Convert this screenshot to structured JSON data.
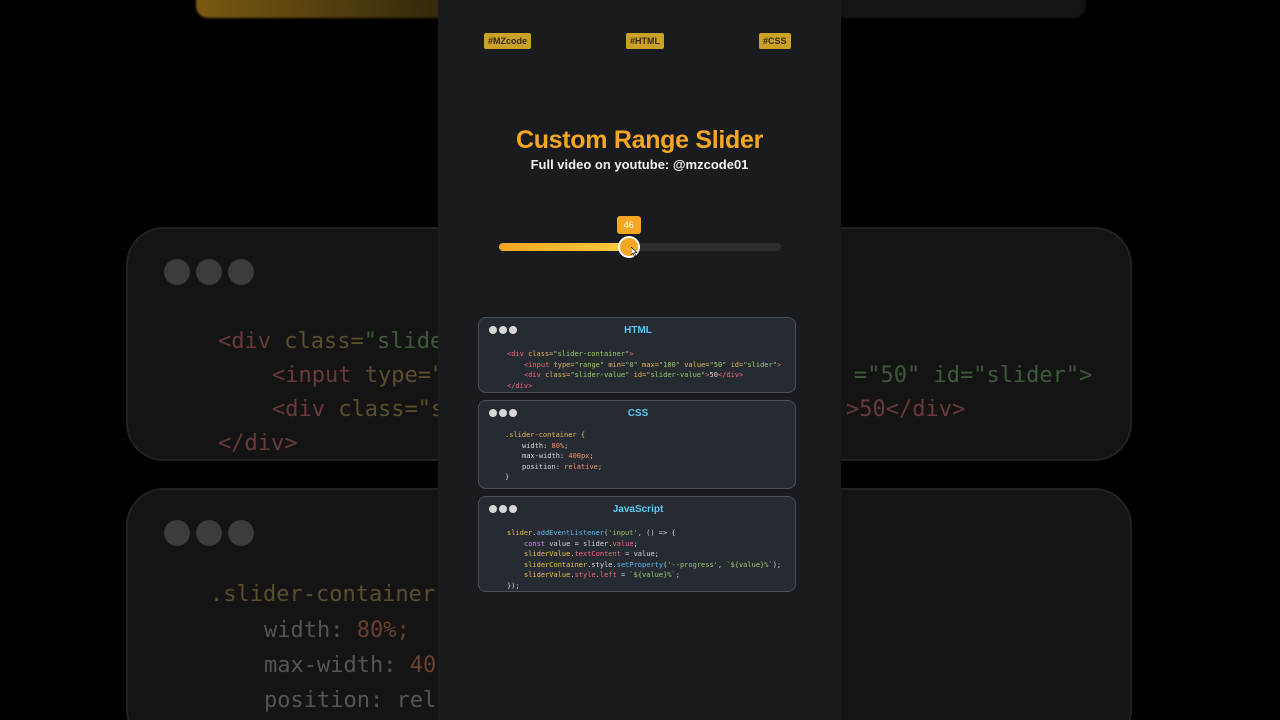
{
  "tags": [
    "#MZcode",
    "#HTML",
    "#CSS"
  ],
  "title": "Custom Range Slider",
  "subtitle": "Full video on youtube: @mzcode01",
  "slider": {
    "value": 46,
    "value_label": "46",
    "min": 0,
    "max": 100
  },
  "cards": [
    {
      "title": "HTML"
    },
    {
      "title": "CSS"
    },
    {
      "title": "JavaScript"
    }
  ],
  "html_code": {
    "line1_open": "<div ",
    "line1_attr": "class=",
    "line1_str": "\"slider-container\"",
    "line1_close": ">",
    "line2_open": "<input ",
    "line2_a1": "type=",
    "line2_s1": "\"range\"",
    "line2_a2": " min=",
    "line2_s2": "\"0\"",
    "line2_a3": " max=",
    "line2_s3": "\"100\"",
    "line2_a4": " value=",
    "line2_s4": "\"50\"",
    "line2_a5": " id=",
    "line2_s5": "\"slider\"",
    "line2_close": ">",
    "line3_open": "<div ",
    "line3_a1": "class=",
    "line3_s1": "\"slider-value\"",
    "line3_a2": " id=",
    "line3_s2": "\"slider-value\"",
    "line3_mid": ">",
    "line3_text": "50",
    "line3_close": "</div>",
    "line4": "</div>"
  },
  "css_code": {
    "selector": ".slider-container {",
    "p1": "width: ",
    "v1": "80%",
    "p2": "max-width: ",
    "v2": "400px",
    "p3": "position: ",
    "v3": "relative",
    "semicolon": ";",
    "close": "}"
  },
  "js_code": {
    "l1_var": "slider",
    "l1_dot": ".",
    "l1_fn": "addEventListener",
    "l1_rest": "(",
    "l1_str": "'input'",
    "l1_end": ", () => {",
    "l2_kw": "const",
    "l2_rest": " value = slider.",
    "l2_prop": "value",
    "l2_end": ";",
    "l3_var": "sliderValue",
    "l3_dot": ".",
    "l3_prop": "textContent",
    "l3_end": " = value;",
    "l4_var": "sliderContainer",
    "l4_mid": ".style.",
    "l4_fn": "setProperty",
    "l4_p": "(",
    "l4_s1": "'--progress'",
    "l4_c": ", ",
    "l4_s2": "`${value}%`",
    "l4_end": ");",
    "l5_var": "sliderValue",
    "l5_mid": ".",
    "l5_prop": "style",
    "l5_dot": ".",
    "l5_prop2": "left",
    "l5_eq": " = ",
    "l5_s": "`${value}%`",
    "l5_end": ";",
    "l6": "});"
  },
  "background": {
    "html_lines": {
      "l1_tag": "<div ",
      "l1_attr": "class=",
      "l1_str": "\"slide",
      "l2_tag": "<input ",
      "l2_attr": "type=\"",
      "l2_right": "=\"50\" id=\"slider\">",
      "l3_tag": "<div ",
      "l3_attr": "class=\"s",
      "l3_right": ">50</div>",
      "l4": "</div>"
    },
    "css_lines": {
      "l1": ".slider-container",
      "l2a": "width: ",
      "l2b": "80%;",
      "l3a": "max-width: ",
      "l3b": "40",
      "l4": "position: rel"
    }
  },
  "colors": {
    "accent": "#f5a623",
    "panel_bg": "#1a1b1f",
    "card_bg": "#262a31",
    "card_title": "#5cc8f2",
    "tag_bg": "#c9a227"
  }
}
